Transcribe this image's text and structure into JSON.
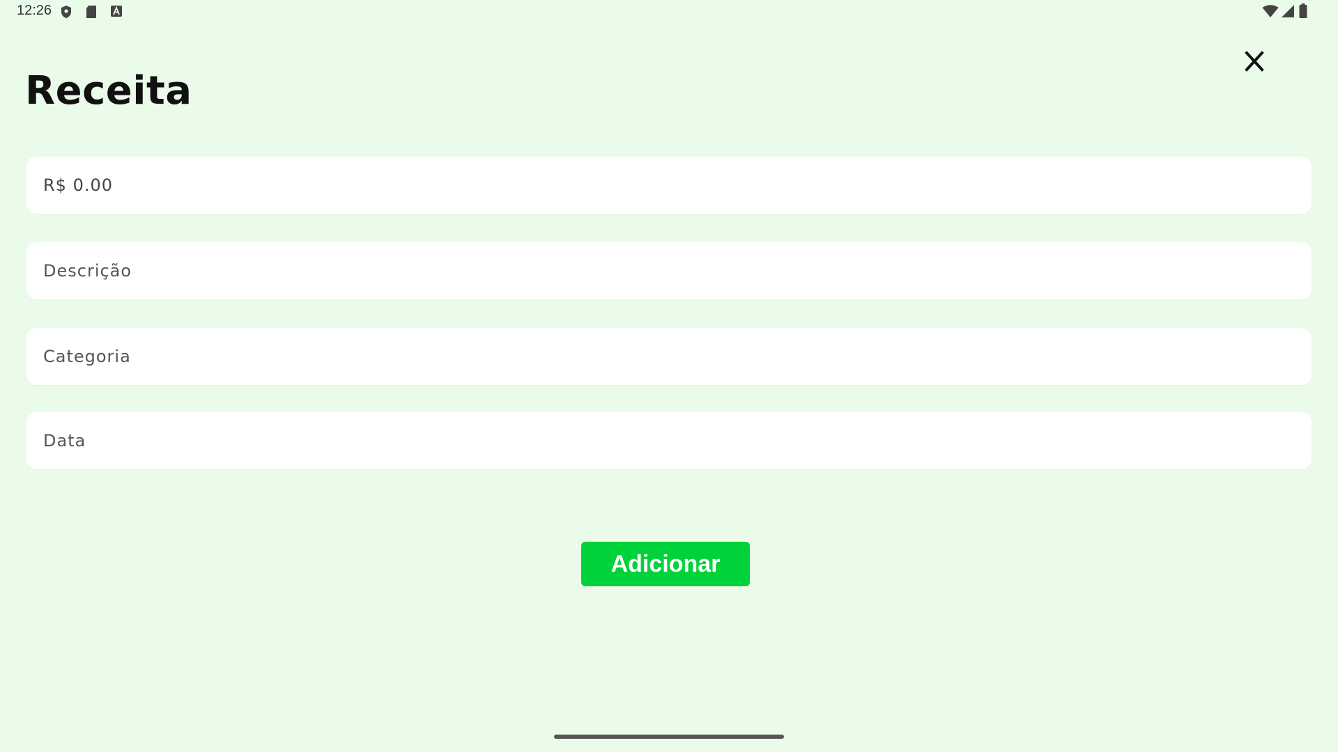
{
  "status_bar": {
    "time": "12:26",
    "left_icons": [
      "shield-icon",
      "sd-card-icon",
      "keyboard-a-icon"
    ],
    "right_icons": [
      "wifi-icon",
      "cell-signal-icon",
      "battery-icon"
    ]
  },
  "header": {
    "title": "Receita",
    "close_icon": "close-icon"
  },
  "form": {
    "valor": {
      "value": "R$ 0.00",
      "placeholder": ""
    },
    "descricao": {
      "value": "",
      "placeholder": "Descrição"
    },
    "categoria": {
      "value": "",
      "placeholder": "Categoria"
    },
    "data": {
      "value": "",
      "placeholder": "Data"
    }
  },
  "actions": {
    "add_label": "Adicionar"
  },
  "colors": {
    "background": "#eafce9",
    "field_background": "#ffffff",
    "accent": "#00d339",
    "text": "#111111"
  }
}
